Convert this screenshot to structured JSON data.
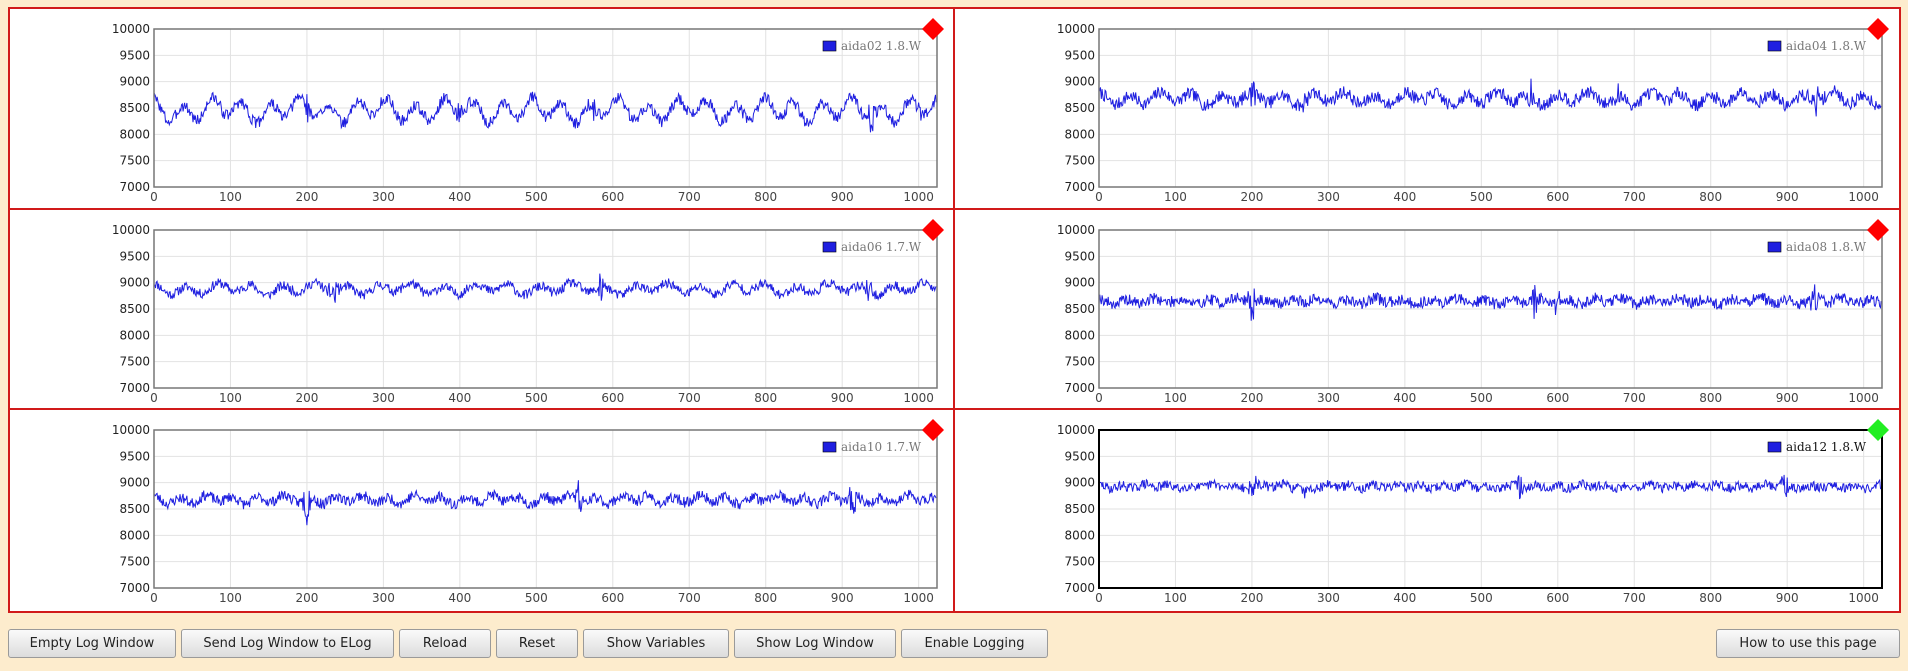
{
  "colors": {
    "background": "#fdeccd",
    "panel_border": "#d11a1a",
    "series": "#1f1fe0",
    "status_alarm": "#ff0000",
    "status_ok": "#22ee22"
  },
  "chart_data": [
    {
      "type": "line",
      "legend_label": "aida02 1.8.W",
      "status": "alarm",
      "status_icon": "red-diamond-icon",
      "selected": false,
      "xlim": [
        0,
        1024
      ],
      "ylim": [
        7000,
        10000
      ],
      "xticks": [
        "0",
        "100",
        "200",
        "300",
        "400",
        "500",
        "600",
        "700",
        "800",
        "900",
        "1000"
      ],
      "yticks": [
        "10000",
        "9500",
        "9000",
        "8500",
        "8000",
        "7500",
        "7000"
      ],
      "baseline": 8460,
      "noise": 110,
      "slow_amp": 170,
      "slow_period": 38,
      "bursts": [
        [
          200,
          320
        ],
        [
          400,
          260
        ],
        [
          575,
          300
        ],
        [
          940,
          420
        ],
        [
          1000,
          250
        ]
      ],
      "seed": 3
    },
    {
      "type": "line",
      "legend_label": "aida04 1.8.W",
      "status": "alarm",
      "status_icon": "red-diamond-icon",
      "selected": false,
      "xlim": [
        0,
        1024
      ],
      "ylim": [
        7000,
        10000
      ],
      "xticks": [
        "0",
        "100",
        "200",
        "300",
        "400",
        "500",
        "600",
        "700",
        "800",
        "900",
        "1000"
      ],
      "yticks": [
        "10000",
        "9500",
        "9000",
        "8500",
        "8000",
        "7500",
        "7000"
      ],
      "baseline": 8680,
      "noise": 120,
      "slow_amp": 90,
      "slow_period": 40,
      "bursts": [
        [
          200,
          320
        ],
        [
          270,
          250
        ],
        [
          565,
          330
        ],
        [
          680,
          220
        ],
        [
          940,
          300
        ]
      ],
      "seed": 7
    },
    {
      "type": "line",
      "legend_label": "aida06 1.7.W",
      "status": "alarm",
      "status_icon": "red-diamond-icon",
      "selected": false,
      "xlim": [
        0,
        1024
      ],
      "ylim": [
        7000,
        10000
      ],
      "xticks": [
        "0",
        "100",
        "200",
        "300",
        "400",
        "500",
        "600",
        "700",
        "800",
        "900",
        "1000"
      ],
      "yticks": [
        "10000",
        "9500",
        "9000",
        "8500",
        "8000",
        "7500",
        "7000"
      ],
      "baseline": 8880,
      "noise": 90,
      "slow_amp": 80,
      "slow_period": 42,
      "bursts": [
        [
          235,
          420
        ],
        [
          585,
          420
        ],
        [
          935,
          330
        ]
      ],
      "seed": 11
    },
    {
      "type": "line",
      "legend_label": "aida08 1.8.W",
      "status": "alarm",
      "status_icon": "red-diamond-icon",
      "selected": false,
      "xlim": [
        0,
        1024
      ],
      "ylim": [
        7000,
        10000
      ],
      "xticks": [
        "0",
        "100",
        "200",
        "300",
        "400",
        "500",
        "600",
        "700",
        "800",
        "900",
        "1000"
      ],
      "yticks": [
        "10000",
        "9500",
        "9000",
        "8500",
        "8000",
        "7500",
        "7000"
      ],
      "baseline": 8650,
      "noise": 110,
      "slow_amp": 40,
      "slow_period": 36,
      "bursts": [
        [
          200,
          330
        ],
        [
          570,
          360
        ],
        [
          600,
          300
        ],
        [
          935,
          340
        ]
      ],
      "seed": 19
    },
    {
      "type": "line",
      "legend_label": "aida10 1.7.W",
      "status": "alarm",
      "status_icon": "red-diamond-icon",
      "selected": false,
      "xlim": [
        0,
        1024
      ],
      "ylim": [
        7000,
        10000
      ],
      "xticks": [
        "0",
        "100",
        "200",
        "300",
        "400",
        "500",
        "600",
        "700",
        "800",
        "900",
        "1000"
      ],
      "yticks": [
        "10000",
        "9500",
        "9000",
        "8500",
        "8000",
        "7500",
        "7000"
      ],
      "baseline": 8680,
      "noise": 100,
      "slow_amp": 60,
      "slow_period": 34,
      "bursts": [
        [
          200,
          500
        ],
        [
          555,
          400
        ],
        [
          915,
          450
        ]
      ],
      "seed": 23
    },
    {
      "type": "line",
      "legend_label": "aida12 1.8.W",
      "status": "ok",
      "status_icon": "green-diamond-icon",
      "selected": true,
      "xlim": [
        0,
        1024
      ],
      "ylim": [
        7000,
        10000
      ],
      "xticks": [
        "0",
        "100",
        "200",
        "300",
        "400",
        "500",
        "600",
        "700",
        "800",
        "900",
        "1000"
      ],
      "yticks": [
        "10000",
        "9500",
        "9000",
        "8500",
        "8000",
        "7500",
        "7000"
      ],
      "baseline": 8930,
      "noise": 90,
      "slow_amp": 30,
      "slow_period": 30,
      "bursts": [
        [
          200,
          330
        ],
        [
          270,
          230
        ],
        [
          550,
          340
        ],
        [
          895,
          390
        ]
      ],
      "seed": 29
    }
  ],
  "toolbar": {
    "buttons": [
      {
        "id": "empty-log-window",
        "label": "Empty Log Window"
      },
      {
        "id": "send-log-window-to-elog",
        "label": "Send Log Window to ELog"
      },
      {
        "id": "reload",
        "label": "Reload"
      },
      {
        "id": "reset",
        "label": "Reset"
      },
      {
        "id": "show-variables",
        "label": "Show Variables"
      },
      {
        "id": "show-log-window",
        "label": "Show Log Window"
      },
      {
        "id": "enable-logging",
        "label": "Enable Logging"
      }
    ],
    "help_button": {
      "id": "how-to-use",
      "label": "How to use this page"
    }
  }
}
